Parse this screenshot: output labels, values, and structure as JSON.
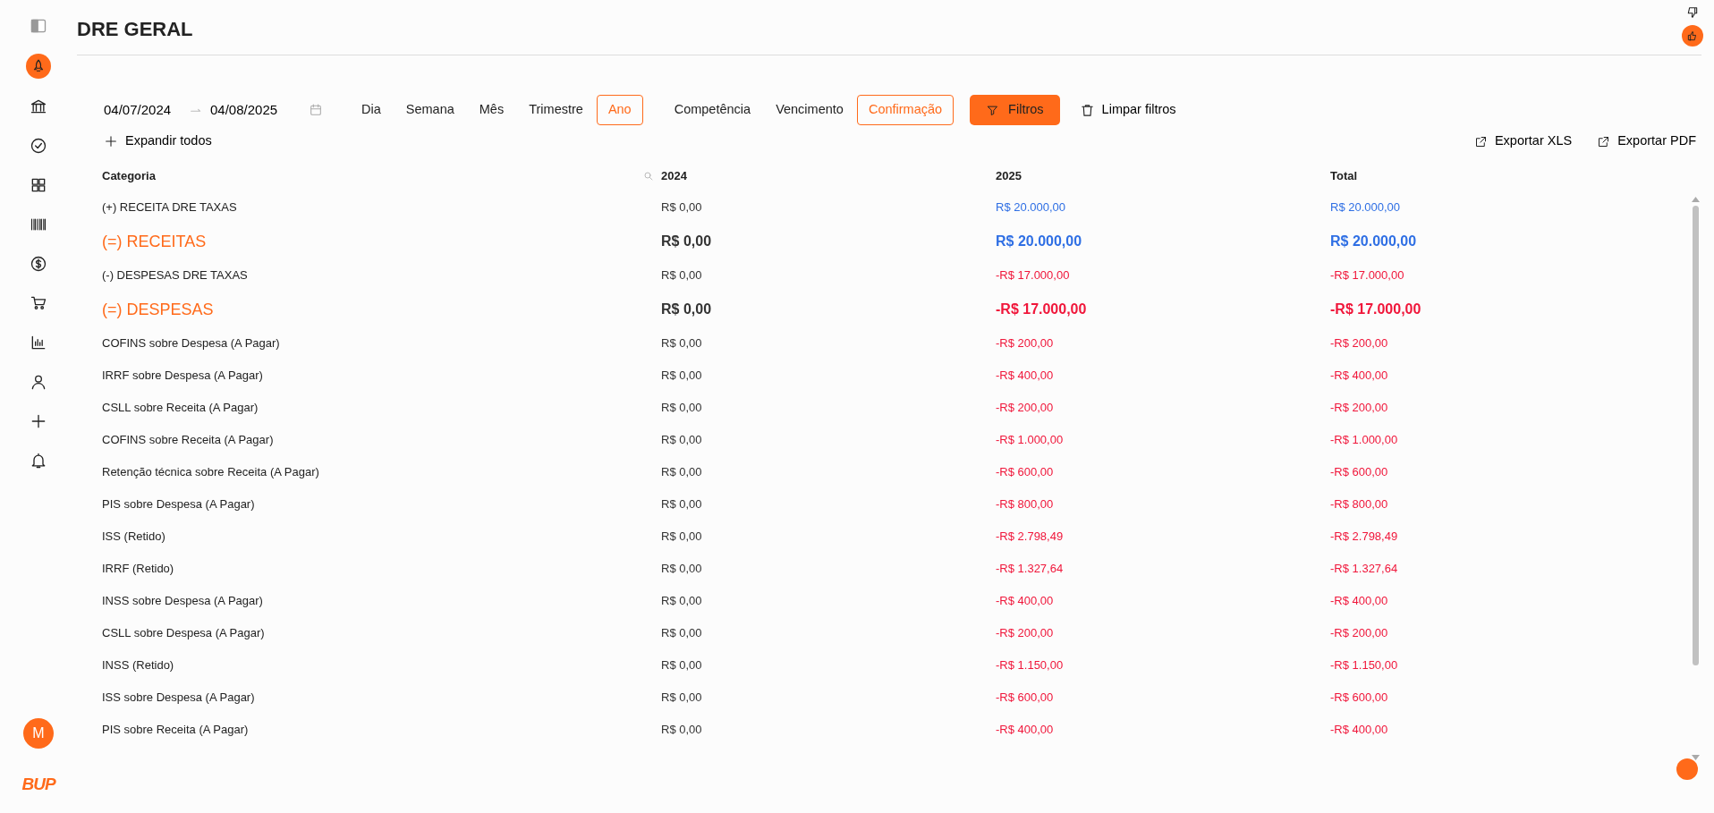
{
  "sidebar": {
    "items": [
      {
        "kind": "panel"
      },
      {
        "kind": "rocket",
        "selected": true
      },
      {
        "kind": "bank",
        "selected": false
      },
      {
        "kind": "check",
        "selected": false
      },
      {
        "kind": "grid",
        "selected": false
      },
      {
        "kind": "barcode",
        "selected": false
      },
      {
        "kind": "dollar",
        "selected": false
      },
      {
        "kind": "cart",
        "selected": false
      },
      {
        "kind": "chart",
        "selected": false
      },
      {
        "kind": "user",
        "selected": false
      },
      {
        "kind": "plus",
        "selected": false
      },
      {
        "kind": "bell",
        "selected": false
      }
    ],
    "avatar": "M",
    "logo": "BUP"
  },
  "page_title": "DRE GERAL",
  "date_range": {
    "start": "04/07/2024",
    "end": "04/08/2025"
  },
  "period_tabs": [
    {
      "label": "Dia",
      "selected": false
    },
    {
      "label": "Semana",
      "selected": false
    },
    {
      "label": "Mês",
      "selected": false
    },
    {
      "label": "Trimestre",
      "selected": false
    },
    {
      "label": "Ano",
      "selected": true
    }
  ],
  "basis_tabs": [
    {
      "label": "Competência",
      "selected": false
    },
    {
      "label": "Vencimento",
      "selected": false
    },
    {
      "label": "Confirmação",
      "selected": true
    }
  ],
  "filter_button": "Filtros",
  "clear_button": "Limpar filtros",
  "expand_button": "Expandir todos",
  "export_buttons": [
    "Exportar XLS",
    "Exportar PDF"
  ],
  "table": {
    "columns": [
      "Categoria",
      "2024",
      "2025",
      "Total"
    ],
    "rows": [
      {
        "kind": "item",
        "cells": [
          {
            "text": "(+) RECEITA DRE TAXAS"
          },
          {
            "text": "R$ 0,00",
            "color": "#333333"
          },
          {
            "text": "R$ 20.000,00",
            "color": "#2f6fe4"
          },
          {
            "text": "R$ 20.000,00",
            "color": "#2f6fe4"
          }
        ]
      },
      {
        "kind": "total",
        "cells": [
          {
            "text": "(=) RECEITAS"
          },
          {
            "text": "R$ 0,00",
            "color": "#333333"
          },
          {
            "text": "R$ 20.000,00",
            "color": "#2f6fe4"
          },
          {
            "text": "R$ 20.000,00",
            "color": "#2f6fe4"
          }
        ]
      },
      {
        "kind": "item",
        "cells": [
          {
            "text": "(-) DESPESAS DRE TAXAS"
          },
          {
            "text": "R$ 0,00",
            "color": "#333333"
          },
          {
            "text": "-R$ 17.000,00",
            "color": "#f0163a"
          },
          {
            "text": "-R$ 17.000,00",
            "color": "#f0163a"
          }
        ]
      },
      {
        "kind": "total",
        "cells": [
          {
            "text": "(=) DESPESAS"
          },
          {
            "text": "R$ 0,00",
            "color": "#333333"
          },
          {
            "text": "-R$ 17.000,00",
            "color": "#f0163a"
          },
          {
            "text": "-R$ 17.000,00",
            "color": "#f0163a"
          }
        ]
      },
      {
        "kind": "item",
        "cells": [
          {
            "text": "COFINS sobre Despesa (A Pagar)"
          },
          {
            "text": "R$ 0,00",
            "color": "#333333"
          },
          {
            "text": "-R$ 200,00",
            "color": "#f0163a"
          },
          {
            "text": "-R$ 200,00",
            "color": "#f0163a"
          }
        ]
      },
      {
        "kind": "item",
        "cells": [
          {
            "text": "IRRF sobre Despesa (A Pagar)"
          },
          {
            "text": "R$ 0,00",
            "color": "#333333"
          },
          {
            "text": "-R$ 400,00",
            "color": "#f0163a"
          },
          {
            "text": "-R$ 400,00",
            "color": "#f0163a"
          }
        ]
      },
      {
        "kind": "item",
        "cells": [
          {
            "text": "CSLL sobre Receita (A Pagar)"
          },
          {
            "text": "R$ 0,00",
            "color": "#333333"
          },
          {
            "text": "-R$ 200,00",
            "color": "#f0163a"
          },
          {
            "text": "-R$ 200,00",
            "color": "#f0163a"
          }
        ]
      },
      {
        "kind": "item",
        "cells": [
          {
            "text": "COFINS sobre Receita (A Pagar)"
          },
          {
            "text": "R$ 0,00",
            "color": "#333333"
          },
          {
            "text": "-R$ 1.000,00",
            "color": "#f0163a"
          },
          {
            "text": "-R$ 1.000,00",
            "color": "#f0163a"
          }
        ]
      },
      {
        "kind": "item",
        "cells": [
          {
            "text": "Retenção técnica sobre Receita (A Pagar)"
          },
          {
            "text": "R$ 0,00",
            "color": "#333333"
          },
          {
            "text": "-R$ 600,00",
            "color": "#f0163a"
          },
          {
            "text": "-R$ 600,00",
            "color": "#f0163a"
          }
        ]
      },
      {
        "kind": "item",
        "cells": [
          {
            "text": "PIS sobre Despesa (A Pagar)"
          },
          {
            "text": "R$ 0,00",
            "color": "#333333"
          },
          {
            "text": "-R$ 800,00",
            "color": "#f0163a"
          },
          {
            "text": "-R$ 800,00",
            "color": "#f0163a"
          }
        ]
      },
      {
        "kind": "item",
        "cells": [
          {
            "text": "ISS (Retido)"
          },
          {
            "text": "R$ 0,00",
            "color": "#333333"
          },
          {
            "text": "-R$ 2.798,49",
            "color": "#f0163a"
          },
          {
            "text": "-R$ 2.798,49",
            "color": "#f0163a"
          }
        ]
      },
      {
        "kind": "item",
        "cells": [
          {
            "text": "IRRF (Retido)"
          },
          {
            "text": "R$ 0,00",
            "color": "#333333"
          },
          {
            "text": "-R$ 1.327,64",
            "color": "#f0163a"
          },
          {
            "text": "-R$ 1.327,64",
            "color": "#f0163a"
          }
        ]
      },
      {
        "kind": "item",
        "cells": [
          {
            "text": "INSS sobre Despesa (A Pagar)"
          },
          {
            "text": "R$ 0,00",
            "color": "#333333"
          },
          {
            "text": "-R$ 400,00",
            "color": "#f0163a"
          },
          {
            "text": "-R$ 400,00",
            "color": "#f0163a"
          }
        ]
      },
      {
        "kind": "item",
        "cells": [
          {
            "text": "CSLL sobre Despesa (A Pagar)"
          },
          {
            "text": "R$ 0,00",
            "color": "#333333"
          },
          {
            "text": "-R$ 200,00",
            "color": "#f0163a"
          },
          {
            "text": "-R$ 200,00",
            "color": "#f0163a"
          }
        ]
      },
      {
        "kind": "item",
        "cells": [
          {
            "text": "INSS (Retido)"
          },
          {
            "text": "R$ 0,00",
            "color": "#333333"
          },
          {
            "text": "-R$ 1.150,00",
            "color": "#f0163a"
          },
          {
            "text": "-R$ 1.150,00",
            "color": "#f0163a"
          }
        ]
      },
      {
        "kind": "item",
        "cells": [
          {
            "text": "ISS sobre Despesa (A Pagar)"
          },
          {
            "text": "R$ 0,00",
            "color": "#333333"
          },
          {
            "text": "-R$ 600,00",
            "color": "#f0163a"
          },
          {
            "text": "-R$ 600,00",
            "color": "#f0163a"
          }
        ]
      },
      {
        "kind": "item",
        "cells": [
          {
            "text": "PIS sobre Receita (A Pagar)"
          },
          {
            "text": "R$ 0,00",
            "color": "#333333"
          },
          {
            "text": "-R$ 400,00",
            "color": "#f0163a"
          },
          {
            "text": "-R$ 400,00",
            "color": "#f0163a"
          }
        ]
      }
    ]
  }
}
